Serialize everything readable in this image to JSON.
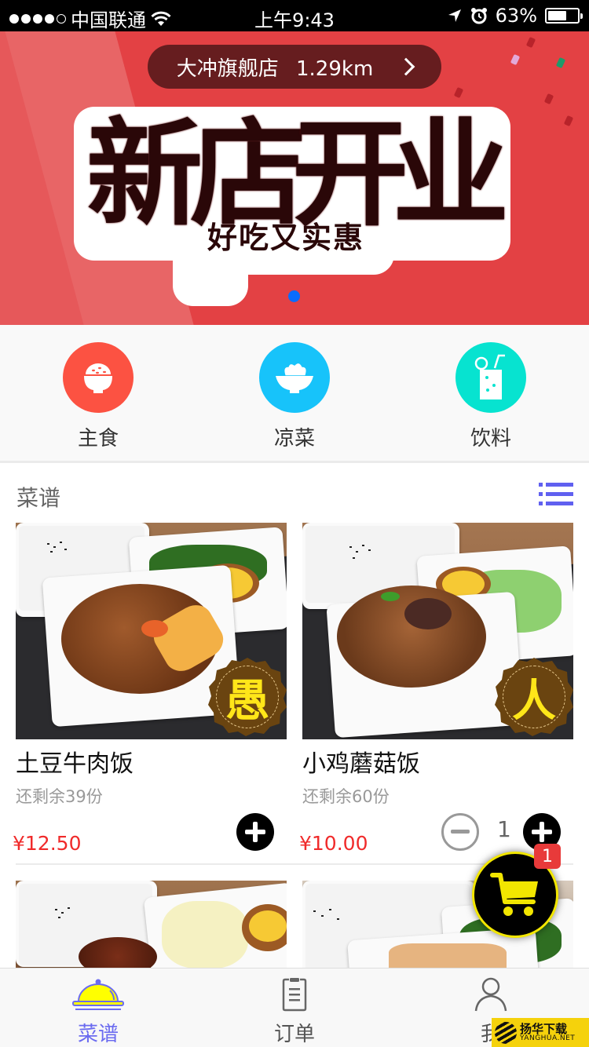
{
  "status_bar": {
    "carrier": "中国联通",
    "signal_bars_filled": 4,
    "signal_bars_total": 5,
    "time": "上午9:43",
    "battery_percent_label": "63%",
    "battery_level": 0.63
  },
  "banner": {
    "store_name": "大冲旗舰店",
    "store_distance": "1.29km",
    "headline_chars": [
      "新",
      "店",
      "开",
      "业"
    ],
    "tagline": "好吃又实惠",
    "page_count": 1,
    "current_page": 1,
    "colors": {
      "background": "#e34144",
      "pill": "#661d1f",
      "pager_dot": "#0a6cff"
    }
  },
  "categories": [
    {
      "label": "主食",
      "icon": "rice-bowl-icon",
      "color": "#fc5242"
    },
    {
      "label": "凉菜",
      "icon": "salad-bowl-icon",
      "color": "#17c3fa"
    },
    {
      "label": "饮料",
      "icon": "drink-glass-icon",
      "color": "#07e3d0"
    }
  ],
  "menu": {
    "title": "菜谱",
    "view_toggle_icon": "list-view-icon",
    "dishes": [
      {
        "name": "土豆牛肉饭",
        "stock": "还剩余39份",
        "price": "¥12.50",
        "badge": "愚",
        "quantity": 0
      },
      {
        "name": "小鸡蘑菇饭",
        "stock": "还剩余60份",
        "price": "¥10.00",
        "badge": "人",
        "quantity": "1"
      },
      {
        "name": "",
        "stock": "",
        "price": "",
        "badge": "",
        "quantity": 0
      },
      {
        "name": "",
        "stock": "",
        "price": "",
        "badge": "",
        "quantity": 0
      }
    ]
  },
  "cart": {
    "icon": "shopping-cart-icon",
    "count": "1",
    "colors": {
      "accent": "#f2e600",
      "badge": "#e83a3a"
    }
  },
  "tab_bar": {
    "active_index": 0,
    "tabs": [
      {
        "label": "菜谱",
        "icon": "food-cloche-icon"
      },
      {
        "label": "订单",
        "icon": "clipboard-icon"
      },
      {
        "label": "我",
        "icon": "person-icon"
      }
    ],
    "colors": {
      "active": "#6b6bf0",
      "inactive": "#555555"
    }
  },
  "watermark": {
    "title": "扬华下载",
    "subtitle": "YANGHUA.NET"
  }
}
